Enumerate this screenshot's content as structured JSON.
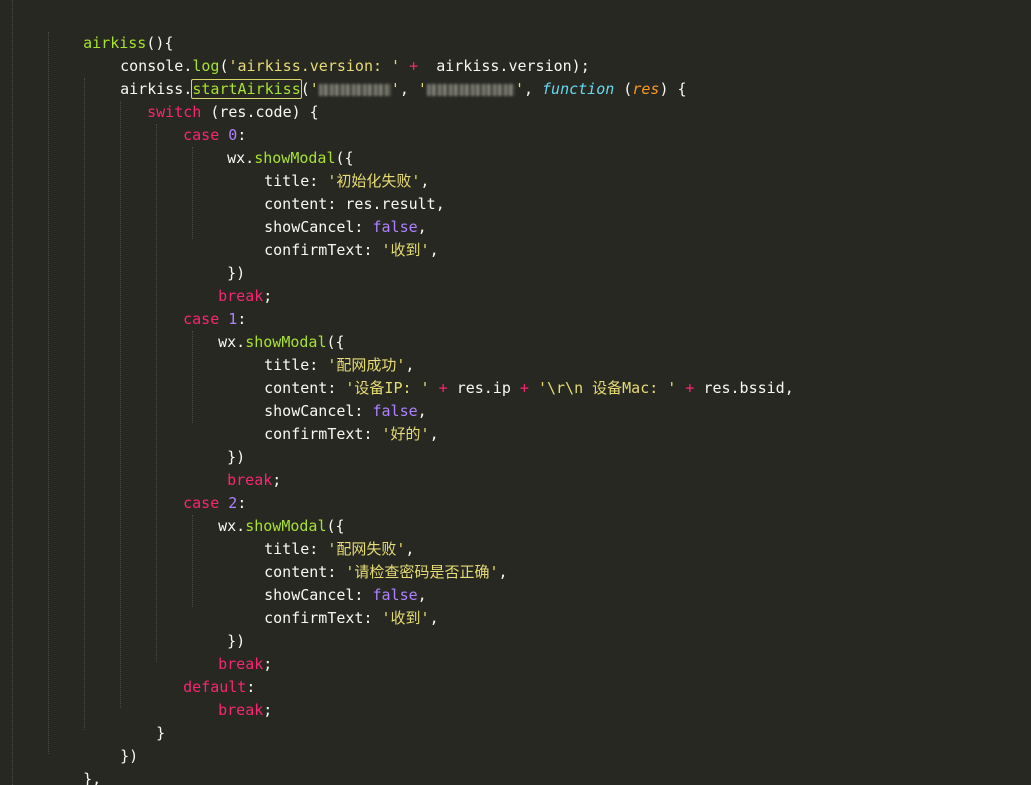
{
  "colors": {
    "background": "#272822",
    "default_text": "#f8f8f2",
    "function_green": "#a6e22e",
    "keyword_pink": "#f92672",
    "string_yellow": "#e6db74",
    "number_purple": "#ae81ff",
    "storage_blue": "#66d9ef",
    "param_orange": "#fd971f",
    "match_highlight": "#d8d56a"
  },
  "code": {
    "fn_name": "airkiss",
    "fn_open": "(){",
    "l2": {
      "obj": "console.",
      "method": "log",
      "open": "(",
      "str": "'airkiss.version: '",
      "op": " + ",
      "rest": " airkiss.version);"
    },
    "l3": {
      "obj": "airkiss.",
      "method": "startAirkiss",
      "open": "(",
      "q1_open": "'",
      "q1_close": "'",
      "sep": ", ",
      "q2_open": "'",
      "q2_close": "'",
      "sep2": ", ",
      "function_kw": "function",
      "paren_open": " (",
      "param": "res",
      "paren_close": ") {"
    },
    "l4": {
      "kw": "switch",
      "rest": " (res.code) {"
    },
    "case_kw": "case",
    "case0": {
      "num": "0",
      "colon": ":"
    },
    "case1": {
      "num": "1",
      "colon": ":"
    },
    "case2": {
      "num": "2",
      "colon": ":"
    },
    "default_kw": "default",
    "default_colon": ":",
    "wx": "wx.",
    "show_modal": "showModal",
    "modal_open": "({",
    "modal_close": "})",
    "break_kw": "break",
    "semicolon": ";",
    "title_key": "title: ",
    "content_key": "content: ",
    "show_cancel_key": "showCancel: ",
    "confirm_key": "confirmText: ",
    "comma": ",",
    "false_kw": "false",
    "m0": {
      "title": "'初始化失败'",
      "content": "res.result",
      "confirm": "'收到'"
    },
    "m1": {
      "title": "'配网成功'",
      "content_str1": "'设备IP: '",
      "plus1": " + ",
      "content_ip": "res.ip",
      "plus2": " + ",
      "content_str2": "'\\r\\n 设备Mac: '",
      "plus3": " + ",
      "content_bssid": "res.bssid",
      "confirm": "'好的'"
    },
    "m2": {
      "title": "'配网失败'",
      "content": "'请检查密码是否正确'",
      "confirm": "'收到'"
    },
    "close_switch": "}",
    "close_cb": "})",
    "close_fn": "},"
  }
}
